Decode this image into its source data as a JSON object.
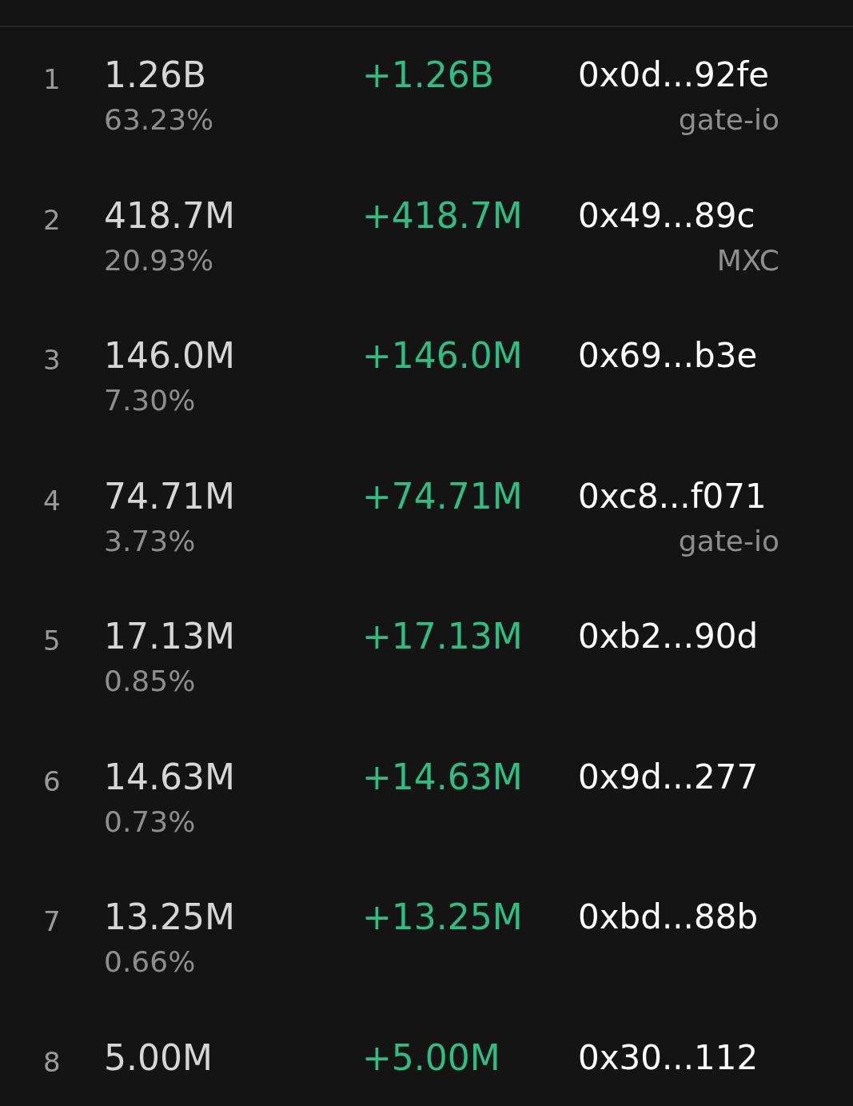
{
  "rows": [
    {
      "rank": "1",
      "amount": "1.26B",
      "share": "63.23%",
      "change": "+1.26B",
      "address": "0x0d...92fe",
      "tag": "gate-io"
    },
    {
      "rank": "2",
      "amount": "418.7M",
      "share": "20.93%",
      "change": "+418.7M",
      "address": "0x49...89c",
      "tag": "MXC"
    },
    {
      "rank": "3",
      "amount": "146.0M",
      "share": "7.30%",
      "change": "+146.0M",
      "address": "0x69...b3e"
    },
    {
      "rank": "4",
      "amount": "74.71M",
      "share": "3.73%",
      "change": "+74.71M",
      "address": "0xc8...f071",
      "tag": "gate-io"
    },
    {
      "rank": "5",
      "amount": "17.13M",
      "share": "0.85%",
      "change": "+17.13M",
      "address": "0xb2...90d"
    },
    {
      "rank": "6",
      "amount": "14.63M",
      "share": "0.73%",
      "change": "+14.63M",
      "address": "0x9d...277"
    },
    {
      "rank": "7",
      "amount": "13.25M",
      "share": "0.66%",
      "change": "+13.25M",
      "address": "0xbd...88b"
    },
    {
      "rank": "8",
      "amount": "5.00M",
      "change": "+5.00M",
      "address": "0x30...112"
    }
  ]
}
